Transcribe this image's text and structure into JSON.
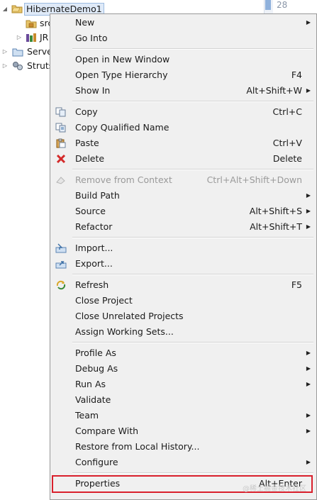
{
  "tree": {
    "items": [
      {
        "label": "HibernateDemo1",
        "icon": "project-folder-icon",
        "expanded": true
      },
      {
        "label": "src",
        "icon": "package-folder-icon"
      },
      {
        "label": "JR",
        "icon": "jre-library-icon"
      },
      {
        "label": "Serve",
        "icon": "servers-folder-icon"
      },
      {
        "label": "Struts",
        "icon": "struts-project-icon"
      }
    ]
  },
  "editor": {
    "line_number": "28"
  },
  "menu": {
    "items": [
      {
        "label": "New",
        "accelerator": "",
        "submenu": true
      },
      {
        "label": "Go Into",
        "accelerator": "",
        "submenu": false
      },
      {
        "label": "Open in New Window",
        "accelerator": "",
        "submenu": false
      },
      {
        "label": "Open Type Hierarchy",
        "accelerator": "F4",
        "submenu": false
      },
      {
        "label": "Show In",
        "accelerator": "Alt+Shift+W",
        "submenu": true
      },
      {
        "label": "Copy",
        "accelerator": "Ctrl+C",
        "submenu": false,
        "icon": "copy-icon"
      },
      {
        "label": "Copy Qualified Name",
        "accelerator": "",
        "submenu": false,
        "icon": "copy-qualified-name-icon"
      },
      {
        "label": "Paste",
        "accelerator": "Ctrl+V",
        "submenu": false,
        "icon": "paste-icon"
      },
      {
        "label": "Delete",
        "accelerator": "Delete",
        "submenu": false,
        "icon": "delete-icon"
      },
      {
        "label": "Remove from Context",
        "accelerator": "Ctrl+Alt+Shift+Down",
        "submenu": false,
        "disabled": true,
        "icon": "remove-context-icon"
      },
      {
        "label": "Build Path",
        "accelerator": "",
        "submenu": true
      },
      {
        "label": "Source",
        "accelerator": "Alt+Shift+S",
        "submenu": true
      },
      {
        "label": "Refactor",
        "accelerator": "Alt+Shift+T",
        "submenu": true
      },
      {
        "label": "Import...",
        "accelerator": "",
        "submenu": false,
        "icon": "import-icon"
      },
      {
        "label": "Export...",
        "accelerator": "",
        "submenu": false,
        "icon": "export-icon"
      },
      {
        "label": "Refresh",
        "accelerator": "F5",
        "submenu": false,
        "icon": "refresh-icon"
      },
      {
        "label": "Close Project",
        "accelerator": "",
        "submenu": false
      },
      {
        "label": "Close Unrelated Projects",
        "accelerator": "",
        "submenu": false
      },
      {
        "label": "Assign Working Sets...",
        "accelerator": "",
        "submenu": false
      },
      {
        "label": "Profile As",
        "accelerator": "",
        "submenu": true
      },
      {
        "label": "Debug As",
        "accelerator": "",
        "submenu": true
      },
      {
        "label": "Run As",
        "accelerator": "",
        "submenu": true
      },
      {
        "label": "Validate",
        "accelerator": "",
        "submenu": false
      },
      {
        "label": "Team",
        "accelerator": "",
        "submenu": true
      },
      {
        "label": "Compare With",
        "accelerator": "",
        "submenu": true
      },
      {
        "label": "Restore from Local History...",
        "accelerator": "",
        "submenu": false
      },
      {
        "label": "Configure",
        "accelerator": "",
        "submenu": true
      },
      {
        "label": "Properties",
        "accelerator": "Alt+Enter",
        "submenu": false,
        "highlighted": true
      }
    ]
  },
  "watermark": "@稀土掘金技术社区",
  "colors": {
    "highlight_border": "#d9202c",
    "menu_bg": "#f0f0f0",
    "selection_bg": "#dfeaf8"
  }
}
